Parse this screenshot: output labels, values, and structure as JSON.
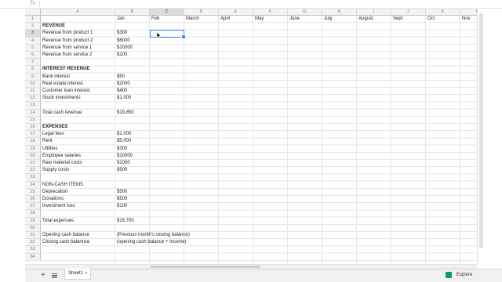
{
  "formula_bar": {
    "fx_label": "fx",
    "content": ""
  },
  "grid": {
    "column_headers": [
      "A",
      "B",
      "C",
      "D",
      "E",
      "F",
      "G",
      "H",
      "I",
      "J",
      "K",
      "L"
    ],
    "selected_column": "C",
    "selected_row": "3",
    "row_numbers": [
      "1",
      "2",
      "3",
      "4",
      "5",
      "6",
      "7",
      "8",
      "9",
      "10",
      "11",
      "12",
      "13",
      "14",
      "15",
      "16",
      "17",
      "18",
      "19",
      "20",
      "21",
      "22",
      "23",
      "24",
      "25",
      "26",
      "27",
      "28",
      "29",
      "30",
      "31",
      "32",
      "33",
      "34"
    ],
    "months": [
      "Jan",
      "Feb",
      "March",
      "April",
      "May",
      "June",
      "July",
      "August",
      "Sept",
      "Oct",
      "Nov"
    ],
    "rows": [
      {
        "row": "2",
        "label": "REVENUE",
        "value": "",
        "bold": true
      },
      {
        "row": "3",
        "label": "Revenue from product 1",
        "value": "$300"
      },
      {
        "row": "4",
        "label": "Revenue from product 2",
        "value": "$6000"
      },
      {
        "row": "5",
        "label": "Revenue from service 1",
        "value": "$10000"
      },
      {
        "row": "6",
        "label": "Revenue from service 2",
        "value": "$100"
      },
      {
        "row": "8",
        "label": "INTEREST REVENUE",
        "value": "",
        "bold": true
      },
      {
        "row": "9",
        "label": "Bank interest",
        "value": "$50"
      },
      {
        "row": "10",
        "label": "Real estate interest",
        "value": "$2000"
      },
      {
        "row": "11",
        "label": "Customer loan interest",
        "value": "$400"
      },
      {
        "row": "12",
        "label": "Stock investments",
        "value": "$1,000"
      },
      {
        "row": "14",
        "label": "Total cash revenue",
        "value": "$19,850"
      },
      {
        "row": "16",
        "label": "EXPENSES",
        "value": "",
        "bold": true
      },
      {
        "row": "17",
        "label": "Legal fees",
        "value": "$1,000"
      },
      {
        "row": "18",
        "label": "Rent",
        "value": "$5,000"
      },
      {
        "row": "19",
        "label": "Utilities",
        "value": "$300"
      },
      {
        "row": "20",
        "label": "Employee salaries",
        "value": "$10000"
      },
      {
        "row": "21",
        "label": "Raw material costs",
        "value": "$1000"
      },
      {
        "row": "22",
        "label": "Supply costs",
        "value": "$500"
      },
      {
        "row": "24",
        "label": "NON-CASH ITEMS",
        "value": ""
      },
      {
        "row": "25",
        "label": "Deprecation",
        "value": "$500"
      },
      {
        "row": "26",
        "label": "Donations",
        "value": "$500"
      },
      {
        "row": "27",
        "label": "Investment loss",
        "value": "$100"
      },
      {
        "row": "29",
        "label": "Total expenses",
        "value": "$16,700"
      },
      {
        "row": "31",
        "label": "Opening cash balance",
        "value": "(Previous month's closing balance)"
      },
      {
        "row": "32",
        "label": "Closing cash balannce",
        "value": "(opening cash balance + income)"
      }
    ]
  },
  "sheet_tabs": {
    "add_label": "+",
    "active_tab": "Sheet1",
    "tab_arrow": "▾"
  },
  "explore": {
    "label": "Explore"
  },
  "colors": {
    "selection": "#4285f4",
    "explore_icon": "#0f9d58"
  }
}
